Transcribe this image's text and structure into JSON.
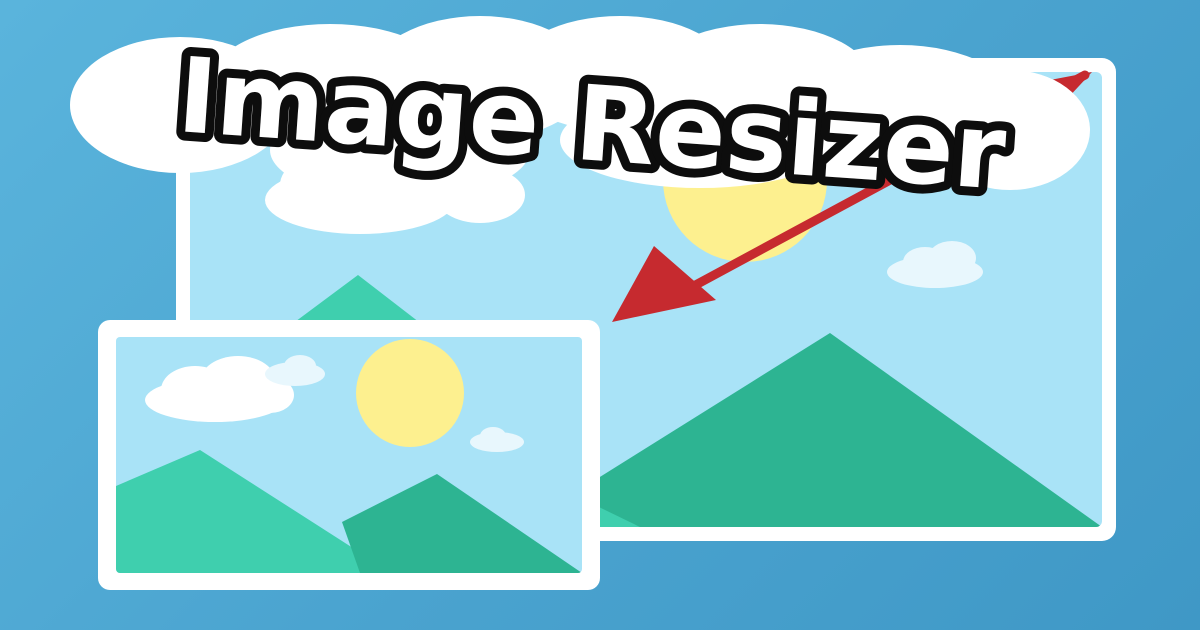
{
  "title": "Image Resizer",
  "colors": {
    "background": "#4ea8d3",
    "frame": "#ffffff",
    "sky": "#a9e3f7",
    "mountain_light": "#3fcfae",
    "mountain_dark": "#2db492",
    "sun": "#fdf08f",
    "cloud": "#ffffff",
    "arrow": "#c62a2f",
    "title_fill": "#ffffff",
    "title_outline": "#0d0d0d"
  },
  "icons": {
    "large_picture": "landscape-photo-icon",
    "small_picture": "landscape-photo-icon",
    "resize_arrow": "diagonal-arrow-icon"
  }
}
